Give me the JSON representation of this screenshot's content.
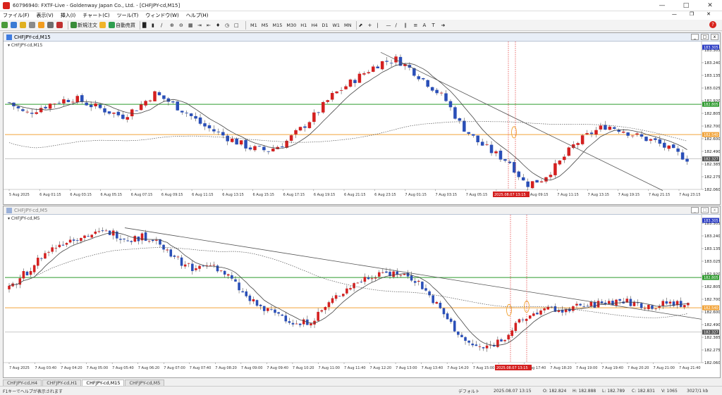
{
  "app": {
    "title": "60796940: FXTF-Live - Goldenway Japan Co., Ltd. - [CHFJPY-cd,M15]"
  },
  "menu": [
    "ファイル(F)",
    "表示(V)",
    "挿入(I)",
    "チャート(C)",
    "ツール(T)",
    "ウィンドウ(W)",
    "ヘルプ(H)"
  ],
  "toolbar": {
    "new_order": "新規注文",
    "auto_trade": "自動売買",
    "timeframes": [
      "M1",
      "M5",
      "M15",
      "M30",
      "H1",
      "H4",
      "D1",
      "W1",
      "MN"
    ]
  },
  "colors": {
    "bull": "#d42020",
    "bear": "#2a4fb8",
    "green_line": "#2e9b2e",
    "orange_line": "#f2a43a",
    "price_tag": "#2b3cc4"
  },
  "chart_top": {
    "window_title": "CHFJPY-cd,M15",
    "label": "CHFJPY-cd,M15",
    "price_labels": [
      "183.305",
      "183.240",
      "183.135",
      "183.025",
      "182.920",
      "182.805",
      "182.700",
      "182.600",
      "182.490",
      "182.385",
      "182.275",
      "182.060"
    ],
    "tags": {
      "top": "183.305",
      "green": "182.805",
      "orange": "182.540",
      "gray": "182.327"
    },
    "time_labels": [
      "5 Aug 2025",
      "6 Aug 01:15",
      "6 Aug 03:15",
      "6 Aug 05:15",
      "6 Aug 07:15",
      "6 Aug 09:15",
      "6 Aug 11:15",
      "6 Aug 13:15",
      "6 Aug 15:15",
      "6 Aug 17:15",
      "6 Aug 19:15",
      "6 Aug 21:15",
      "6 Aug 23:15",
      "7 Aug 01:15",
      "7 Aug 03:15",
      "7 Aug 05:15",
      "7 Aug 07:15",
      "7 Aug 09:15",
      "7 Aug 11:15",
      "7 Aug 13:15",
      "7 Aug 19:15",
      "7 Aug 21:15",
      "7 Aug 23:15"
    ],
    "time_tag": "2025.08.07 13:15"
  },
  "chart_bottom": {
    "window_title": "CHFJPY-cd,M5",
    "label": "CHFJPY-cd,M5",
    "price_labels": [
      "183.305",
      "183.240",
      "183.135",
      "183.025",
      "182.920",
      "182.805",
      "182.700",
      "182.600",
      "182.490",
      "182.385",
      "182.275",
      "182.060"
    ],
    "tags": {
      "top": "183.305",
      "green": "182.805",
      "orange": "182.540",
      "gray": "182.327"
    },
    "time_labels": [
      "7 Aug 2025",
      "7 Aug 03:40",
      "7 Aug 04:20",
      "7 Aug 05:00",
      "7 Aug 05:40",
      "7 Aug 06:20",
      "7 Aug 07:00",
      "7 Aug 07:40",
      "7 Aug 08:20",
      "7 Aug 09:00",
      "7 Aug 09:40",
      "7 Aug 10:20",
      "7 Aug 11:00",
      "7 Aug 11:40",
      "7 Aug 12:20",
      "7 Aug 13:00",
      "7 Aug 13:40",
      "7 Aug 14:20",
      "7 Aug 15:00",
      "7 Aug 15:40",
      "7 Aug 17:40",
      "7 Aug 18:20",
      "7 Aug 19:00",
      "7 Aug 19:40",
      "7 Aug 20:20",
      "7 Aug 21:00",
      "7 Aug 21:40"
    ],
    "time_tag": "2025.08.07 13:15"
  },
  "tabs": [
    "CHFJPY-cd,H4",
    "CHFJPY-cd,H1",
    "CHFJPY-cd,M15",
    "CHFJPY-cd,M5"
  ],
  "active_tab": "CHFJPY-cd,M15",
  "status": {
    "help": "F1キーでヘルプが表示されます",
    "profile": "デフォルト",
    "datetime": "2025.08.07 13:15",
    "open": "O: 182.824",
    "high": "H: 182.888",
    "low": "L: 182.789",
    "close": "C: 182.831",
    "volume": "V: 1065",
    "traffic": "3027/1 kb"
  },
  "chart_data": [
    {
      "type": "candlestick",
      "symbol": "CHFJPY-cd",
      "timeframe": "M15",
      "ylim": [
        182.06,
        183.305
      ],
      "close_path": [
        182.82,
        182.72,
        182.78,
        182.83,
        182.86,
        182.8,
        182.75,
        182.7,
        182.78,
        182.9,
        182.82,
        182.73,
        182.62,
        182.55,
        182.48,
        182.42,
        182.4,
        182.46,
        182.58,
        182.72,
        182.88,
        182.98,
        183.08,
        183.17,
        183.2,
        183.1,
        182.98,
        182.85,
        182.62,
        182.48,
        182.38,
        182.3,
        182.1,
        182.15,
        182.28,
        182.45,
        182.55,
        182.62,
        182.58,
        182.52,
        182.48,
        182.4,
        182.33
      ]
    },
    {
      "type": "candlestick",
      "symbol": "CHFJPY-cd",
      "timeframe": "M5",
      "ylim": [
        182.06,
        183.305
      ],
      "close_path": [
        182.7,
        182.85,
        183.0,
        183.1,
        183.16,
        183.18,
        183.2,
        183.14,
        183.16,
        183.1,
        182.95,
        182.88,
        182.92,
        182.8,
        182.62,
        182.52,
        182.48,
        182.38,
        182.45,
        182.6,
        182.72,
        182.8,
        182.86,
        182.84,
        182.78,
        182.6,
        182.4,
        182.22,
        182.18,
        182.26,
        182.4,
        182.5,
        182.52,
        182.54,
        182.55,
        182.58,
        182.6,
        182.57,
        182.55,
        182.58,
        182.56
      ]
    }
  ]
}
